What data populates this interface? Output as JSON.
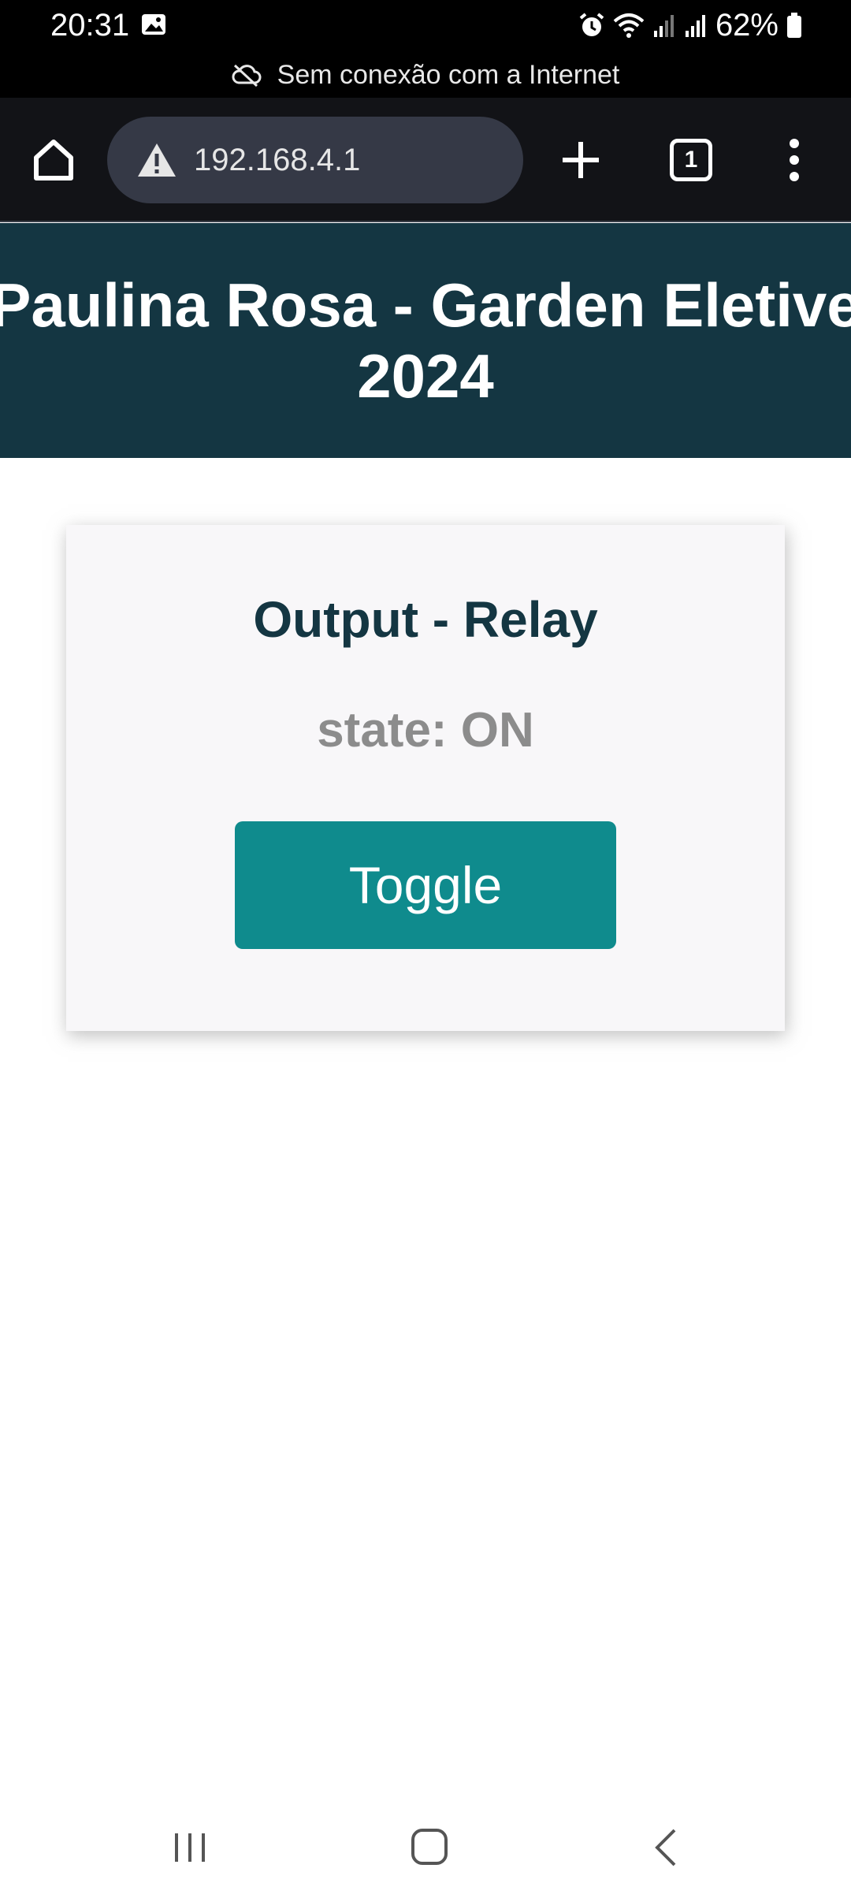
{
  "status_bar": {
    "time": "20:31",
    "battery_percent": "62%",
    "offline_message": "Sem conexão com a Internet",
    "icons": [
      "gallery-icon",
      "alarm-icon",
      "wifi-icon",
      "signal-icon",
      "signal-icon",
      "battery-icon",
      "cloud-off-icon"
    ]
  },
  "browser": {
    "url": "192.168.4.1",
    "tab_count": "1",
    "icons": [
      "home-icon",
      "warning-icon",
      "plus-icon",
      "tabs-icon",
      "more-vert-icon"
    ]
  },
  "page": {
    "header_line1": "Paulina Rosa - Garden Eletive",
    "header_line2": "2024",
    "card": {
      "title": "Output - Relay",
      "state": "state: ON",
      "button_label": "Toggle"
    }
  },
  "nav_bar": {
    "icons": [
      "recents-icon",
      "home-nav-icon",
      "back-icon"
    ]
  },
  "colors": {
    "header_bg": "#143642",
    "card_bg": "#f8f7f9",
    "button_bg": "#0f8b8d",
    "title_text": "#143642",
    "state_text": "#8c8c8c"
  }
}
